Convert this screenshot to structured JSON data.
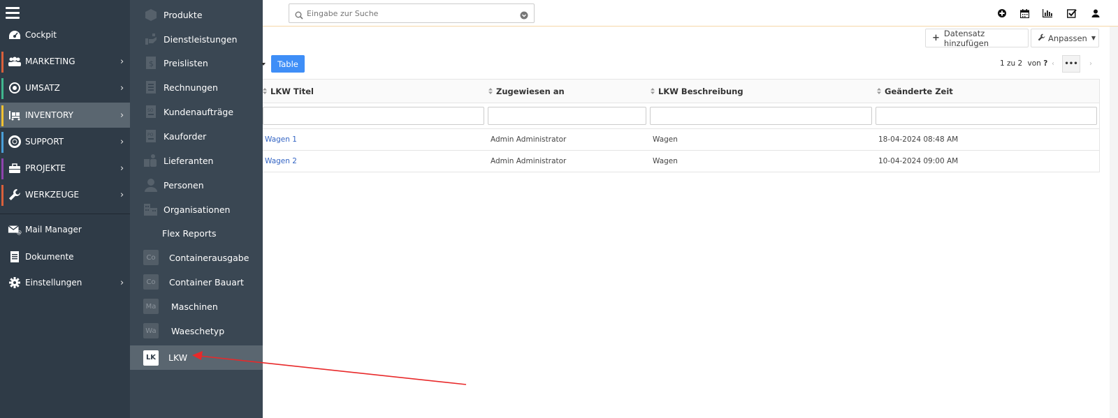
{
  "sidebar": {
    "items": [
      {
        "label": "Cockpit",
        "icon": "dashboard-icon"
      },
      {
        "label": "MARKETING",
        "icon": "users-icon",
        "color": "#d9603b"
      },
      {
        "label": "UMSATZ",
        "icon": "target-icon",
        "color": "#3fb68e"
      },
      {
        "label": "INVENTORY",
        "icon": "inventory-icon",
        "color": "#f1c232"
      },
      {
        "label": "SUPPORT",
        "icon": "lifebuoy-icon",
        "color": "#4a9fd8"
      },
      {
        "label": "PROJEKTE",
        "icon": "briefcase-icon",
        "color": "#8e44ad"
      },
      {
        "label": "WERKZEUGE",
        "icon": "wrench-icon",
        "color": "#d9603b"
      },
      {
        "label": "Mail Manager",
        "icon": "mail-icon"
      },
      {
        "label": "Dokumente",
        "icon": "document-icon"
      },
      {
        "label": "Einstellungen",
        "icon": "gear-icon"
      }
    ]
  },
  "submenu": {
    "items": [
      {
        "label": "Produkte",
        "icon": "box-icon"
      },
      {
        "label": "Dienstleistungen",
        "icon": "hand-icon"
      },
      {
        "label": "Preislisten",
        "icon": "pricelist-icon"
      },
      {
        "label": "Rechnungen",
        "icon": "invoice-icon"
      },
      {
        "label": "Kundenaufträge",
        "icon": "salesorder-icon"
      },
      {
        "label": "Kauforder",
        "icon": "purchaseorder-icon"
      },
      {
        "label": "Lieferanten",
        "icon": "vendor-icon"
      },
      {
        "label": "Personen",
        "icon": "person-icon"
      },
      {
        "label": "Organisationen",
        "icon": "building-icon"
      },
      {
        "label": "Flex Reports",
        "icon": ""
      },
      {
        "label": "Containerausgabe",
        "abbr": "Co"
      },
      {
        "label": "Container Bauart",
        "abbr": "Co"
      },
      {
        "label": "Maschinen",
        "abbr": "Ma"
      },
      {
        "label": "Waeschetyp",
        "abbr": "Wa"
      },
      {
        "label": "LKW",
        "abbr": "LK"
      }
    ]
  },
  "header": {
    "search_placeholder": "Eingabe zur Suche"
  },
  "toolbar": {
    "add_label": "Datensatz hinzufügen",
    "customize_label": "Anpassen",
    "table_label": "Table",
    "pager_range": "1 zu 2",
    "pager_of": "von",
    "pager_total": "?",
    "more_label": "•••"
  },
  "table": {
    "columns": [
      "LKW Titel",
      "Zugewiesen an",
      "LKW Beschreibung",
      "Geänderte Zeit"
    ],
    "rows": [
      [
        "Wagen 1",
        "Admin Administrator",
        "Wagen",
        "18-04-2024 08:48 AM"
      ],
      [
        "Wagen 2",
        "Admin Administrator",
        "Wagen",
        "10-04-2024 09:00 AM"
      ]
    ]
  },
  "annotation_color": "#e8292a"
}
